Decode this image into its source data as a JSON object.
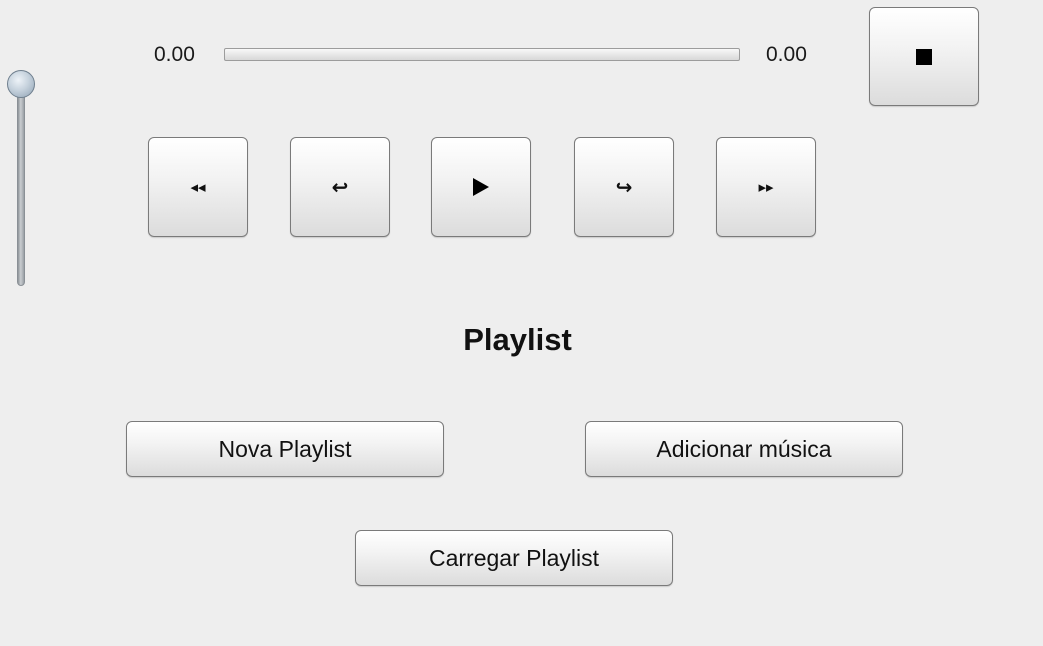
{
  "player": {
    "time_current": "0.00",
    "time_total": "0.00",
    "progress_fraction": 0.0,
    "volume_fraction": 1.0
  },
  "controls": {
    "stop_icon": "stop-icon",
    "rewind_icon": "rewind-icon",
    "previous_icon": "previous-icon",
    "play_icon": "play-icon",
    "next_icon": "next-icon",
    "fast_forward_icon": "fast-forward-icon",
    "rewind_glyph": "◂◂",
    "previous_glyph": "↩",
    "next_glyph": "↪",
    "fast_forward_glyph": "▸▸"
  },
  "playlist": {
    "heading": "Playlist",
    "new_playlist_label": "Nova Playlist",
    "add_music_label": "Adicionar música",
    "load_playlist_label": "Carregar Playlist"
  }
}
